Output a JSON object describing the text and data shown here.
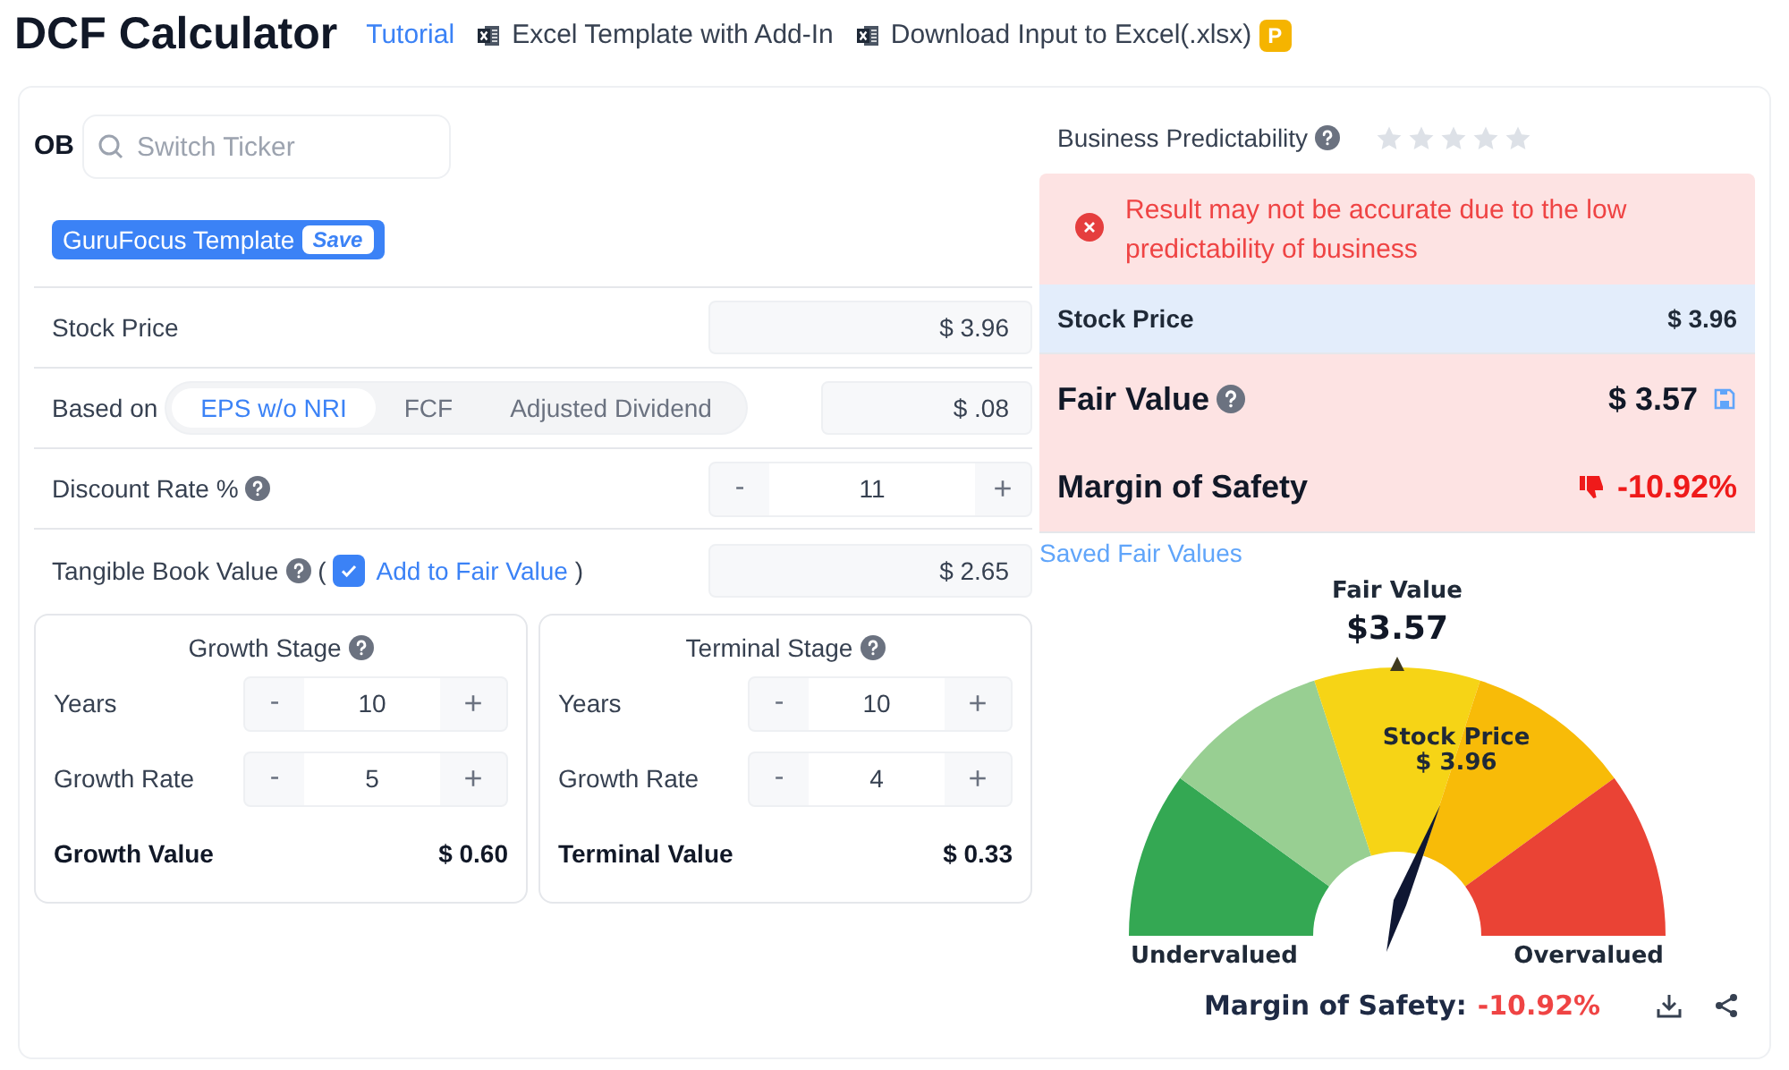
{
  "header": {
    "title": "DCF Calculator",
    "links": [
      {
        "kind": "link",
        "label": "Tutorial"
      },
      {
        "kind": "excel",
        "label": "Excel Template with Add-In"
      },
      {
        "kind": "excel",
        "label": "Download Input to Excel(.xlsx)"
      }
    ],
    "badge": "P"
  },
  "ticker": {
    "symbol": "OB",
    "placeholder": "Switch Ticker"
  },
  "template": {
    "label": "GuruFocus Template",
    "action": "Save"
  },
  "stock_price": {
    "label": "Stock Price",
    "value": "$ 3.96"
  },
  "based_on": {
    "label": "Based on",
    "options": [
      {
        "label": "EPS w/o NRI",
        "selected": true
      },
      {
        "label": "FCF",
        "selected": false
      },
      {
        "label": "Adjusted Dividend",
        "selected": false
      }
    ],
    "value": "$ .08"
  },
  "discount_rate": {
    "label": "Discount Rate %",
    "stepper": {
      "minus": "-",
      "value": "11",
      "plus": "+"
    }
  },
  "tangible_book": {
    "label": "Tangible Book Value",
    "open": "(",
    "checkbox": {
      "label": "Add to Fair Value",
      "checked": true
    },
    "close": ")",
    "value": "$ 2.65"
  },
  "stages": [
    {
      "title": "Growth Stage",
      "rows": [
        {
          "label": "Years",
          "stepper": {
            "minus": "-",
            "value": "10",
            "plus": "+"
          }
        },
        {
          "label": "Growth Rate",
          "stepper": {
            "minus": "-",
            "value": "5",
            "plus": "+"
          }
        }
      ],
      "total_label": "Growth Value",
      "total_value": "$ 0.60"
    },
    {
      "title": "Terminal Stage",
      "rows": [
        {
          "label": "Years",
          "stepper": {
            "minus": "-",
            "value": "10",
            "plus": "+"
          }
        },
        {
          "label": "Growth Rate",
          "stepper": {
            "minus": "-",
            "value": "4",
            "plus": "+"
          }
        }
      ],
      "total_label": "Terminal Value",
      "total_value": "$ 0.33"
    }
  ],
  "predictability": {
    "label": "Business Predictability",
    "stars": 0
  },
  "alert": "Result may not be accurate due to the low predictability of business",
  "summary": {
    "stock_label": "Stock Price",
    "stock_value": "$ 3.96",
    "fair_label": "Fair Value",
    "fair_value": "$ 3.57",
    "mos_label": "Margin of Safety",
    "mos_value": "-10.92%"
  },
  "saved_link": "Saved Fair Values",
  "gauge": {
    "fair_label": "Fair Value",
    "fair_value": "$3.57",
    "stock_label": "Stock Price",
    "stock_value": "$ 3.96",
    "left_label": "Undervalued",
    "right_label": "Overvalued",
    "mos_label": "Margin of Safety:",
    "mos_value": "-10.92%"
  }
}
